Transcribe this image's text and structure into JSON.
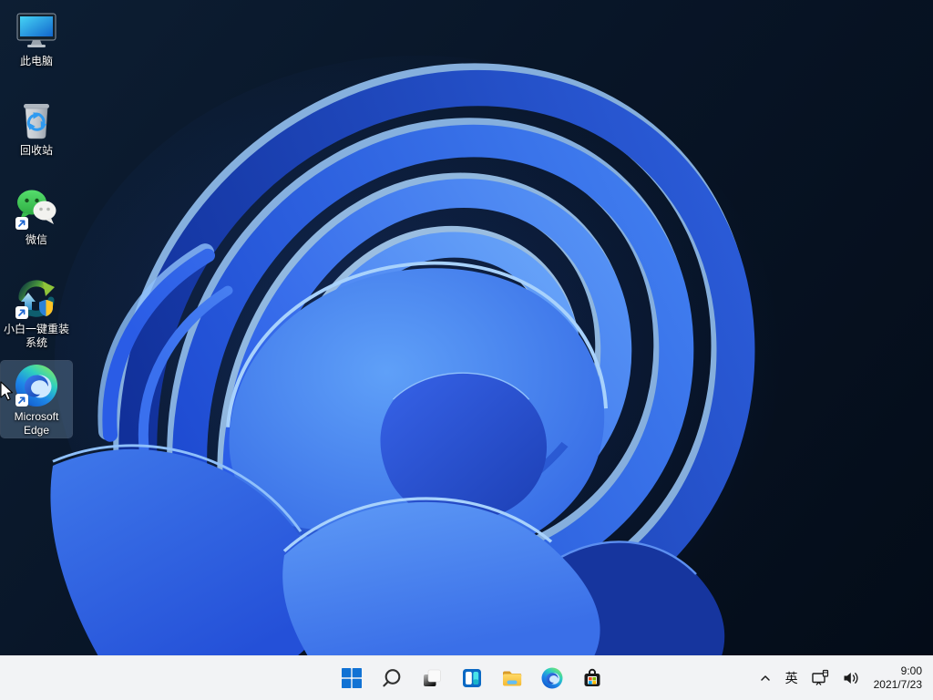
{
  "wallpaper": {
    "name": "windows-11-bloom",
    "background_colors": [
      "#0d1e33",
      "#081527",
      "#040c18"
    ],
    "petal_colors": [
      "#11309a",
      "#1e4bd2",
      "#2a5ce6",
      "#3a70ee",
      "#5490f4",
      "#66a2f8"
    ],
    "rim_highlight": "#9ccafc"
  },
  "desktop": {
    "icons": [
      {
        "id": "this-pc",
        "label": "此电脑",
        "shortcut": false,
        "selected": false
      },
      {
        "id": "recycle-bin",
        "label": "回收站",
        "shortcut": false,
        "selected": false
      },
      {
        "id": "wechat",
        "label": "微信",
        "shortcut": true,
        "selected": false
      },
      {
        "id": "xiaobai-reinstall",
        "label": "小白一键重装系统",
        "shortcut": true,
        "selected": false
      },
      {
        "id": "microsoft-edge",
        "label": "Microsoft Edge",
        "shortcut": true,
        "selected": true
      }
    ]
  },
  "taskbar": {
    "background": "#f2f3f5",
    "accent": "#0f70d7",
    "buttons": [
      {
        "id": "start",
        "icon": "windows-start-icon"
      },
      {
        "id": "search",
        "icon": "search-icon"
      },
      {
        "id": "task-view",
        "icon": "task-view-icon"
      },
      {
        "id": "widgets",
        "icon": "widgets-icon"
      },
      {
        "id": "file-explorer",
        "icon": "folder-icon"
      },
      {
        "id": "edge",
        "icon": "edge-icon"
      },
      {
        "id": "store",
        "icon": "microsoft-store-icon"
      }
    ],
    "tray": {
      "expand_icon": "chevron-up-icon",
      "ime_label": "英",
      "network_icon": "ethernet-icon",
      "volume_icon": "speaker-icon"
    },
    "clock": {
      "time": "9:00",
      "date": "2021/7/23"
    }
  }
}
